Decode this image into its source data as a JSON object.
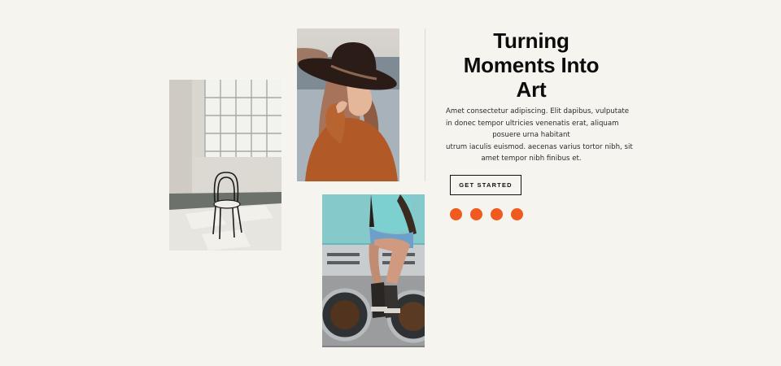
{
  "hero": {
    "title_lines": [
      "Turning",
      "Moments Into",
      "Art"
    ],
    "body_lines": [
      "Amet consectetur adipiscing. Elit dapibus, vulputate",
      "in donec tempor ultricies venenatis erat, aliquam",
      "posuere urna habitant",
      "utrum iaculis euismod. aecenas varius tortor nibh, sit",
      "amet tempor nibh finibus et."
    ],
    "cta_label": "GET STARTED"
  },
  "gallery": {
    "photos": [
      {
        "subject": "empty room with a bentwood chair by a window"
      },
      {
        "subject": "woman in a black wide-brim hat and rust sweater"
      },
      {
        "subject": "person sitting on laundromat washing machines"
      }
    ]
  },
  "slider": {
    "dot_count": 4,
    "accent_color": "#f05a1e"
  },
  "colors": {
    "background": "#f6f4ef",
    "text": "#0c0c0c",
    "accent": "#f05a1e"
  }
}
